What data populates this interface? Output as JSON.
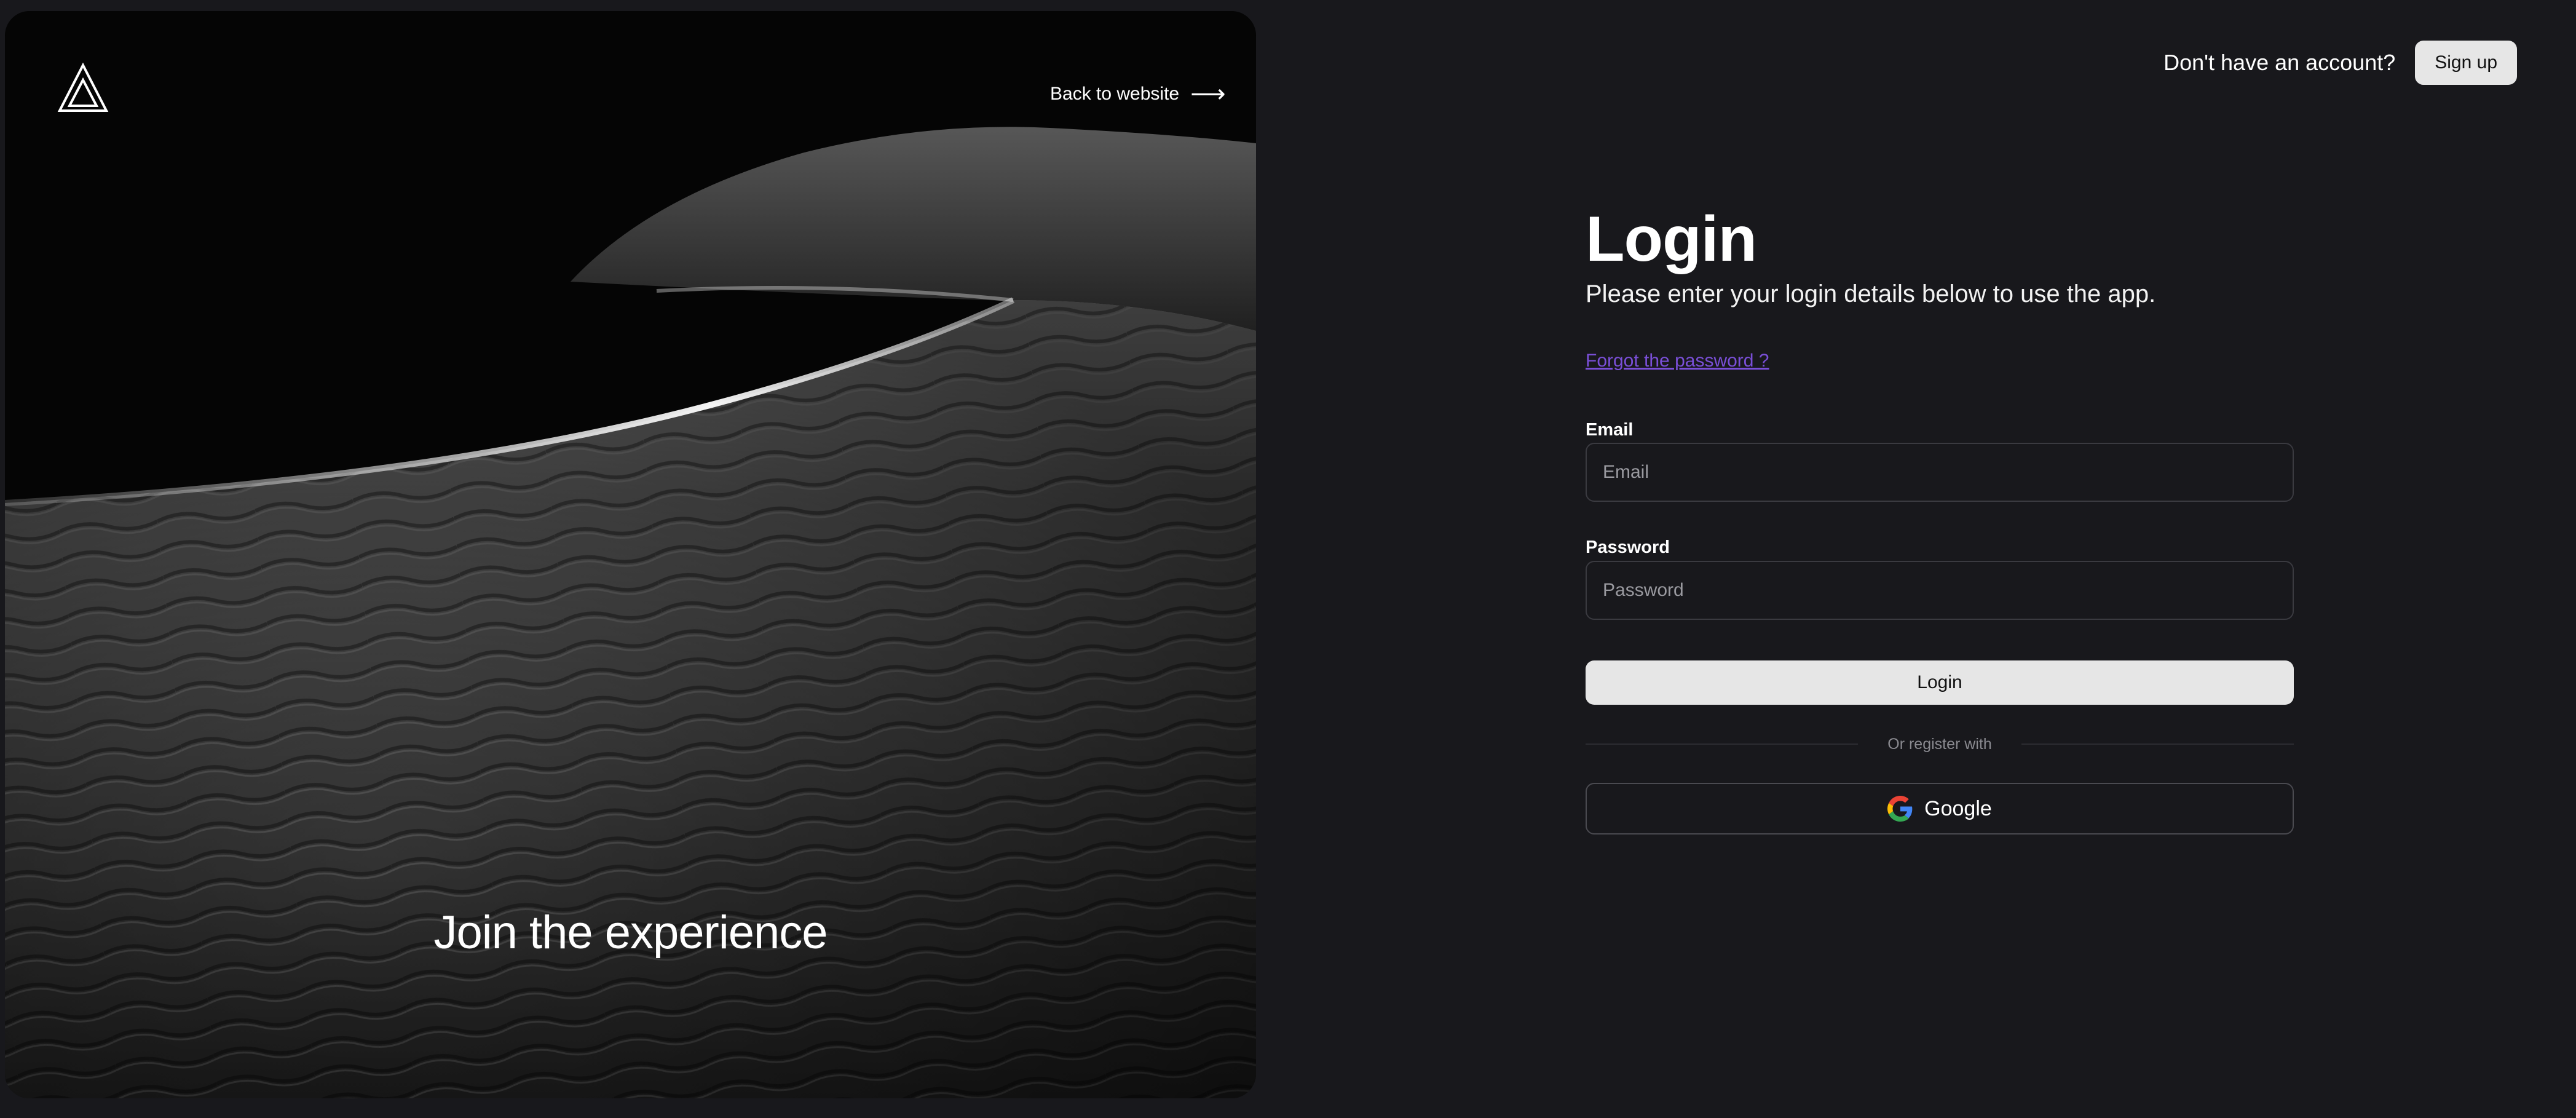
{
  "hero": {
    "back_link": "Back to website",
    "tagline": "Join the experience",
    "icons": {
      "logo": "triangle-logo",
      "arrow": "arrow-right-icon"
    }
  },
  "topbar": {
    "prompt": "Don't have an account?",
    "signup_label": "Sign up"
  },
  "form": {
    "title": "Login",
    "subtitle": "Please enter your login details below to use the app.",
    "forgot_link": "Forgot the password ?",
    "email_label": "Email",
    "email_placeholder": "Email",
    "email_value": "",
    "password_label": "Password",
    "password_placeholder": "Password",
    "password_value": "",
    "login_label": "Login",
    "divider_text": "Or register with",
    "google_label": "Google"
  },
  "colors": {
    "background": "#18181c",
    "button": "#e6e6e6",
    "link": "#7a4fd8",
    "border": "#3a3a40"
  }
}
